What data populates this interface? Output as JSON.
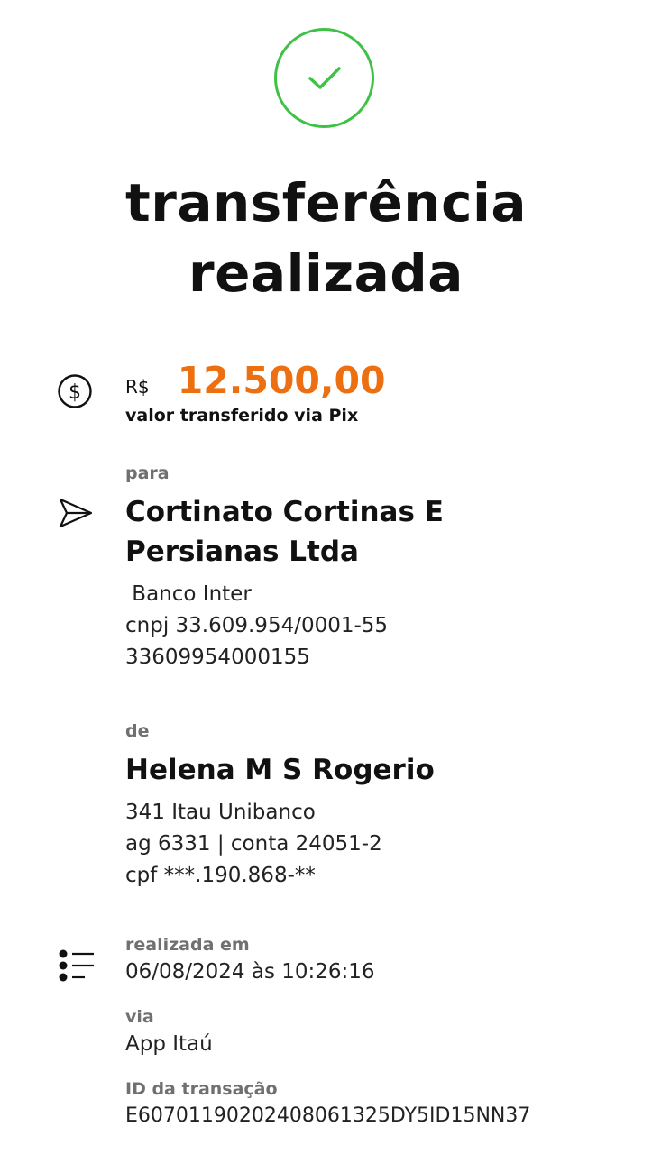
{
  "status": {
    "title_line1": "transferência",
    "title_line2": "realizada",
    "check_color": "#3ec246",
    "icon": "check-icon"
  },
  "amount": {
    "currency": "R$",
    "value": "12.500,00",
    "caption": "valor transferido via Pix",
    "color": "#ec6f11",
    "icon": "dollar-circle-icon"
  },
  "recipient": {
    "label": "para",
    "name_line1": "Cortinato Cortinas E",
    "name_line2": "Persianas Ltda",
    "bank": " Banco Inter",
    "document": "cnpj 33.609.954/0001-55",
    "key": "33609954000155",
    "icon": "send-icon"
  },
  "sender": {
    "label": "de",
    "name": "Helena M S Rogerio",
    "bank": "341 Itau Unibanco",
    "account": "ag 6331 | conta 24051-2",
    "document": "cpf ***.190.868-**"
  },
  "details": {
    "icon": "list-icon",
    "date_label": "realizada em",
    "date_value": "06/08/2024 às 10:26:16",
    "via_label": "via",
    "via_value": "App Itaú",
    "id_label": "ID da transação",
    "id_value": "E60701190202408061325DY5ID15NN37"
  }
}
